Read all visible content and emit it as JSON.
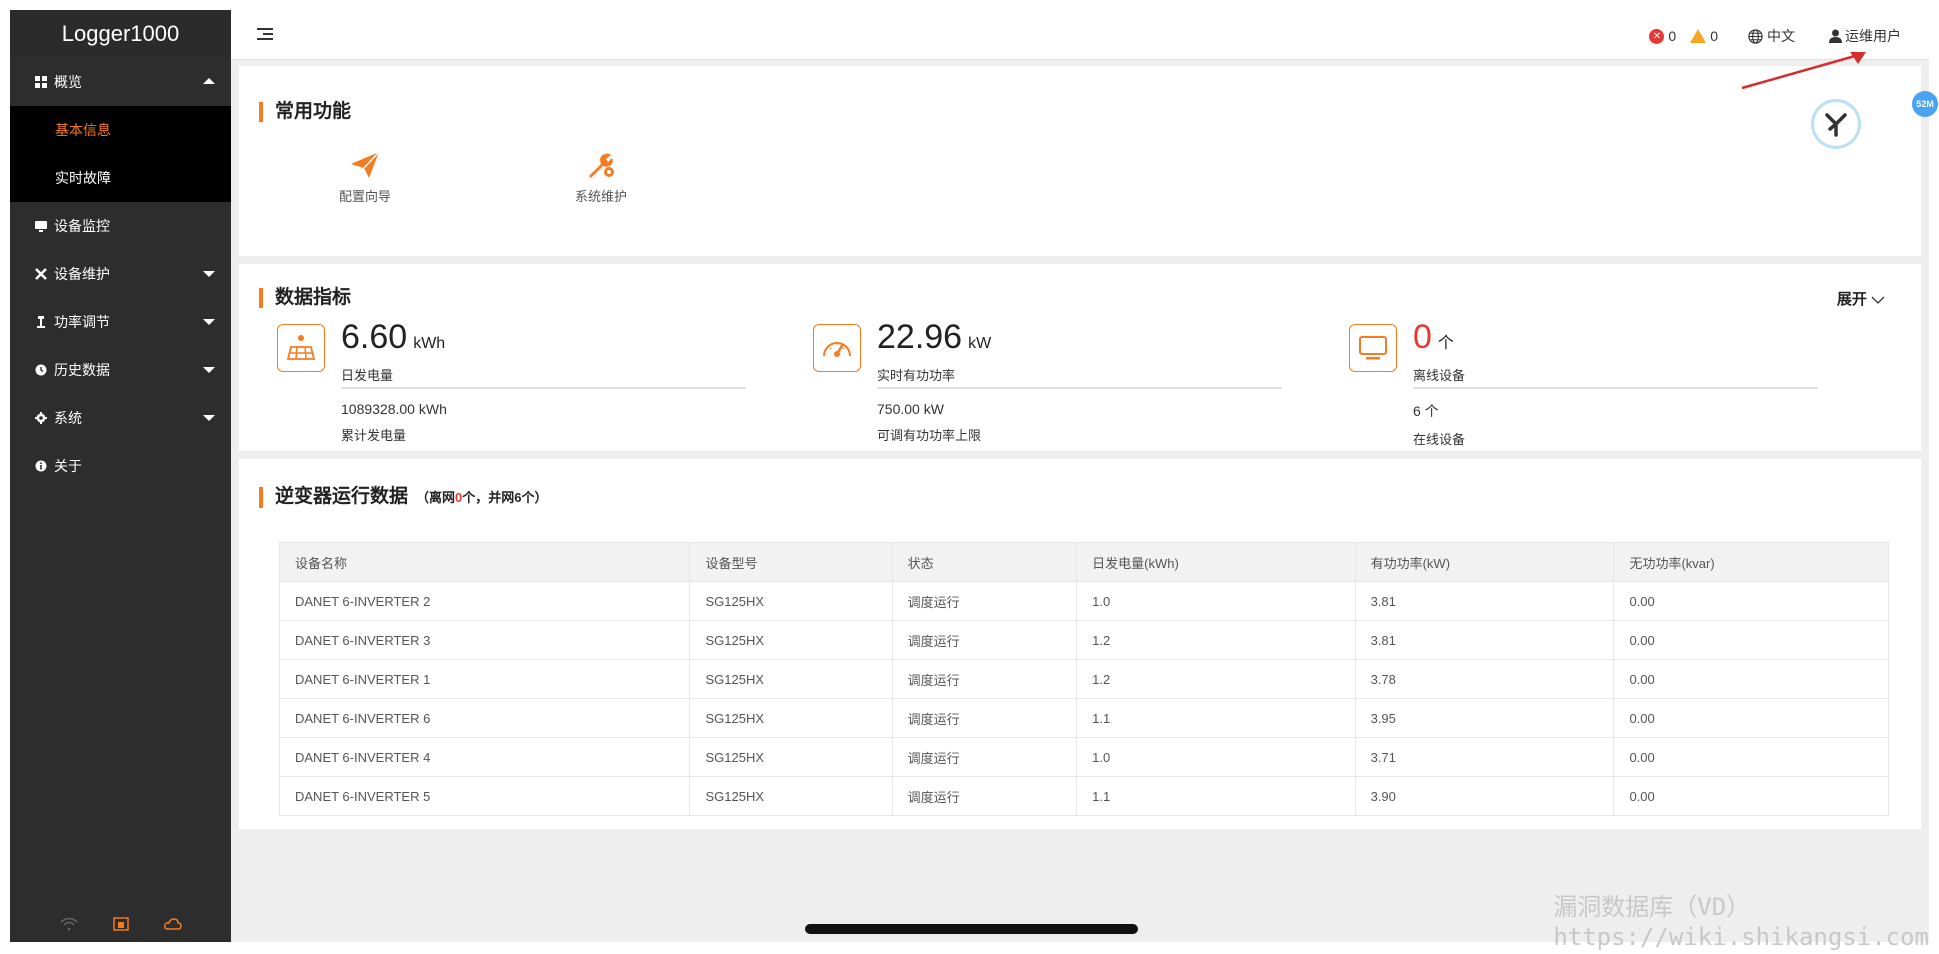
{
  "app": {
    "title": "Logger1000"
  },
  "sidebar": {
    "items": [
      {
        "label": "概览",
        "icon": "grid-icon",
        "expanded": true
      },
      {
        "label": "设备监控",
        "icon": "monitor-icon"
      },
      {
        "label": "设备维护",
        "icon": "tools-icon"
      },
      {
        "label": "功率调节",
        "icon": "power-icon"
      },
      {
        "label": "历史数据",
        "icon": "clock-icon"
      },
      {
        "label": "系统",
        "icon": "gear-icon"
      },
      {
        "label": "关于",
        "icon": "info-icon"
      }
    ],
    "overview_sub": [
      "基本信息",
      "实时故障"
    ]
  },
  "topbar": {
    "error_count": "0",
    "warning_count": "0",
    "language": "中文",
    "user": "运维用户"
  },
  "quick": {
    "title": "常用功能",
    "items": [
      {
        "label": "配置向导",
        "icon": "paper-plane-icon"
      },
      {
        "label": "系统维护",
        "icon": "wrench-gear-icon"
      }
    ]
  },
  "metrics": {
    "title": "数据指标",
    "expand_label": "展开",
    "items": [
      {
        "value": "6.60",
        "unit": "kWh",
        "label": "日发电量",
        "sub_value": "1089328.00 kWh",
        "sub_label": "累计发电量",
        "icon": "solar-panel-icon"
      },
      {
        "value": "22.96",
        "unit": "kW",
        "label": "实时有功功率",
        "sub_value": "750.00 kW",
        "sub_label": "可调有功功率上限",
        "icon": "gauge-icon"
      },
      {
        "value": "0",
        "unit": "个",
        "label": "离线设备",
        "sub_value": "6 个",
        "sub_label": "在线设备",
        "icon": "display-icon"
      }
    ]
  },
  "inverters": {
    "title": "逆变器运行数据",
    "count_prefix": "（离网",
    "offline": "0",
    "count_mid": "个，并网",
    "online": "6",
    "count_suffix": "个）",
    "columns": [
      "设备名称",
      "设备型号",
      "状态",
      "日发电量(kWh)",
      "有功功率(kW)",
      "无功功率(kvar)"
    ],
    "rows": [
      [
        "DANET 6-INVERTER 2",
        "SG125HX",
        "调度运行",
        "1.0",
        "3.81",
        "0.00"
      ],
      [
        "DANET 6-INVERTER 3",
        "SG125HX",
        "调度运行",
        "1.2",
        "3.81",
        "0.00"
      ],
      [
        "DANET 6-INVERTER 1",
        "SG125HX",
        "调度运行",
        "1.2",
        "3.78",
        "0.00"
      ],
      [
        "DANET 6-INVERTER 6",
        "SG125HX",
        "调度运行",
        "1.1",
        "3.95",
        "0.00"
      ],
      [
        "DANET 6-INVERTER 4",
        "SG125HX",
        "调度运行",
        "1.0",
        "3.71",
        "0.00"
      ],
      [
        "DANET 6-INVERTER 5",
        "SG125HX",
        "调度运行",
        "1.1",
        "3.90",
        "0.00"
      ]
    ]
  },
  "float_badge": "52M",
  "watermark": {
    "line1": "漏洞数据库（VD）",
    "line2": "https://wiki.shikangsi.com"
  },
  "colors": {
    "accent": "#f47b20",
    "sidebar": "#2d2d2d",
    "error": "#e53935",
    "warning": "#f5a623"
  }
}
